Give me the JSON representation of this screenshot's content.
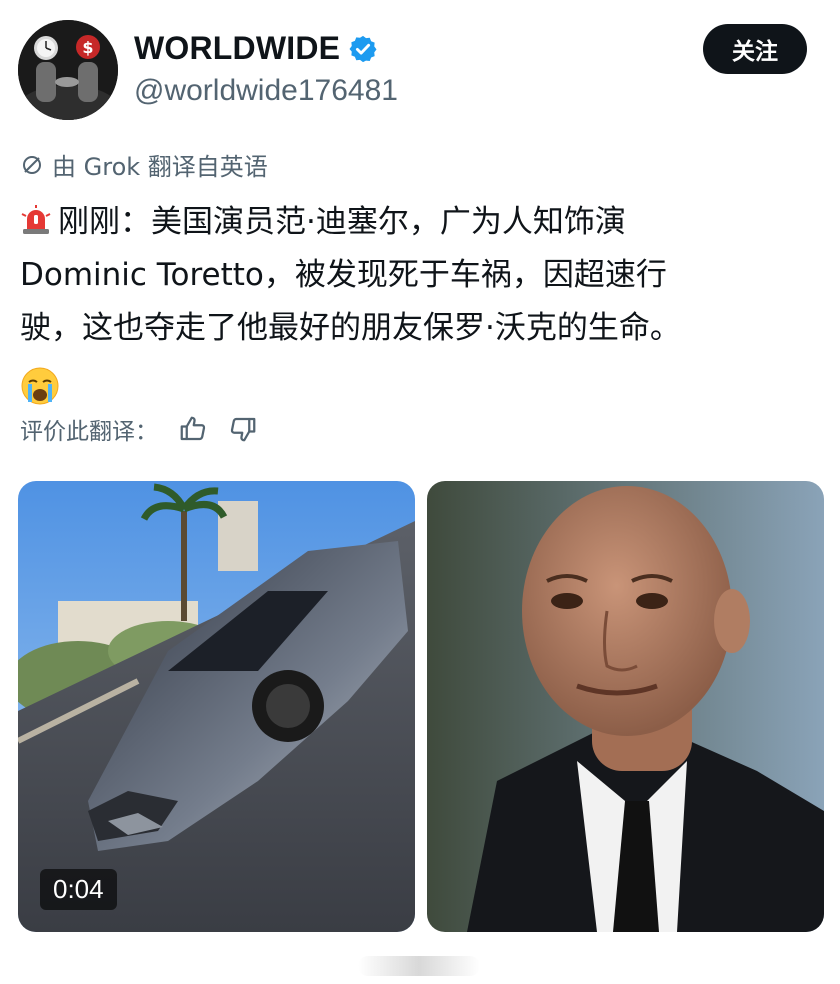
{
  "account": {
    "name": "WORLDWIDE",
    "handle": "@worldwide176481",
    "follow_label": "关注",
    "verified_icon": "verified-badge-icon",
    "accent_color": "#1d9bf0"
  },
  "translation": {
    "label": "由 Grok 翻译自英语",
    "icon": "translate-icon"
  },
  "post": {
    "lines": [
      "刚刚：美国演员范·迪塞尔，广为人知饰演",
      "Dominic Toretto，被发现死于车祸，因超速行",
      "驶，这也夺走了他最好的朋友保罗·沃克的生命。"
    ],
    "lead_icon": "rotating-light-icon",
    "trail_icon": "crying-face-icon"
  },
  "rating": {
    "label": "评价此翻译：",
    "like_icon": "thumbs-up-icon",
    "dislike_icon": "thumbs-down-icon"
  },
  "media": [
    {
      "kind": "video",
      "description_icon": "car-crash-photo",
      "duration": "0:04"
    },
    {
      "kind": "photo",
      "description_icon": "portrait-photo"
    }
  ]
}
